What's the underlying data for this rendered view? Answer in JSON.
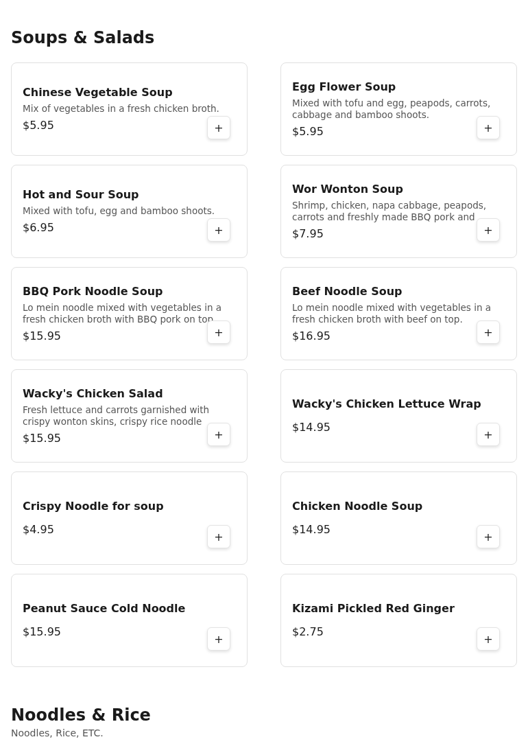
{
  "sections": [
    {
      "title": "Soups & Salads",
      "items": [
        {
          "name": "Chinese Vegetable Soup",
          "description": "Mix of vegetables in a fresh chicken broth.",
          "price": "$5.95",
          "add": "+"
        },
        {
          "name": "Egg Flower Soup",
          "description": "Mixed with tofu and egg, peapods, carrots, cabbage and bamboo shoots.",
          "price": "$5.95",
          "add": "+"
        },
        {
          "name": "Hot and Sour Soup",
          "description": "Mixed with tofu, egg and bamboo shoots.",
          "price": "$6.95",
          "add": "+"
        },
        {
          "name": "Wor Wonton Soup",
          "description": "Shrimp, chicken, napa cabbage, peapods, carrots and freshly made BBQ pork and",
          "price": "$7.95",
          "add": "+"
        },
        {
          "name": "BBQ Pork Noodle Soup",
          "description": "Lo mein noodle mixed with vegetables in a fresh chicken broth with BBQ pork on top",
          "price": "$15.95",
          "add": "+"
        },
        {
          "name": "Beef Noodle Soup",
          "description": "Lo mein noodle mixed with vegetables in a fresh chicken broth with beef on top.",
          "price": "$16.95",
          "add": "+"
        },
        {
          "name": "Wacky's Chicken Salad",
          "description": "Fresh lettuce and carrots garnished with crispy wonton skins, crispy rice noodle",
          "price": "$15.95",
          "add": "+"
        },
        {
          "name": "Wacky's Chicken Lettuce Wrap",
          "price": "$14.95",
          "add": "+"
        },
        {
          "name": "Crispy Noodle for soup",
          "price": "$4.95",
          "add": "+"
        },
        {
          "name": "Chicken Noodle Soup",
          "price": "$14.95",
          "add": "+"
        },
        {
          "name": "Peanut Sauce Cold Noodle",
          "price": "$15.95",
          "add": "+"
        },
        {
          "name": "Kizami Pickled Red Ginger",
          "price": "$2.75",
          "add": "+"
        }
      ]
    },
    {
      "title": "Noodles & Rice",
      "subtitle": "Noodles, Rice, ETC."
    }
  ]
}
